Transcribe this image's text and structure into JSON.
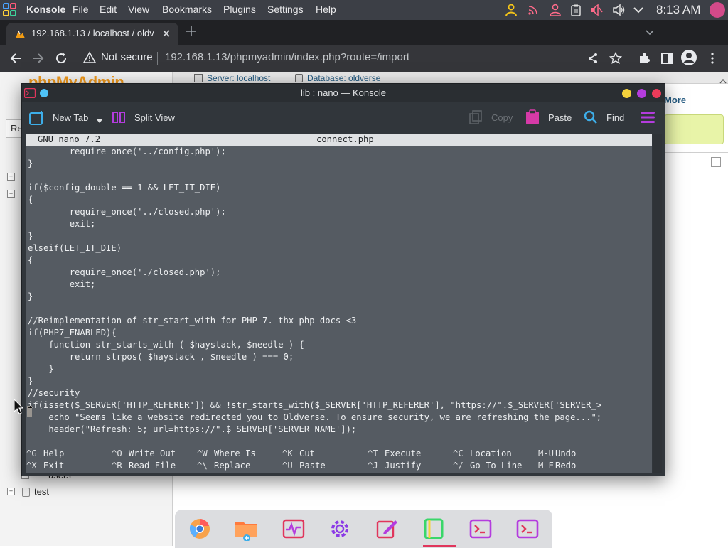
{
  "topbar": {
    "app_name": "Konsole",
    "menu": [
      "File",
      "Edit",
      "View",
      "Bookmarks",
      "Plugins",
      "Settings",
      "Help"
    ],
    "clock": "8:13 AM",
    "bg_color": "#3c3f46"
  },
  "browser": {
    "tab_title": "192.168.1.13 / localhost / oldv",
    "security_label": "Not secure",
    "url": "192.168.1.13/phpmyadmin/index.php?route=/import"
  },
  "pma": {
    "logo_text": "phpMyAdmin",
    "breadcrumb_server": "Server: localhost",
    "breadcrumb_db": "Database: oldverse",
    "more_label": "More",
    "re_button": "Re",
    "tree_items": [
      "users",
      "test"
    ]
  },
  "konsole": {
    "title": "lib : nano — Konsole",
    "new_tab": "New Tab",
    "split_view": "Split View",
    "copy": "Copy",
    "paste": "Paste",
    "find": "Find"
  },
  "nano": {
    "version": "GNU nano 7.2",
    "filename": "connect.php",
    "lines": [
      "        require_once('../config.php');",
      "}",
      "",
      "if($config_double == 1 && LET_IT_DIE)",
      "{",
      "        require_once('../closed.php');",
      "        exit;",
      "}",
      "elseif(LET_IT_DIE)",
      "{",
      "        require_once('./closed.php');",
      "        exit;",
      "}",
      "",
      "//Reimplementation of str_start_with for PHP 7. thx php docs <3",
      "if(PHP7_ENABLED){",
      "    function str_starts_with ( $haystack, $needle ) {",
      "        return strpos( $haystack , $needle ) === 0;",
      "    }",
      "}",
      "//security",
      "if(isset($_SERVER['HTTP_REFERER']) && !str_starts_with($_SERVER['HTTP_REFERER'], \"https://\".$_SERVER['SERVER_>",
      "    echo \"Seems like a website redirected you to Oldverse. To ensure security, we are refreshing the page...\";",
      "    header(\"Refresh: 5; url=https://\".$_SERVER['SERVER_NAME']);"
    ],
    "shortcuts_row1": [
      {
        "key": "^G",
        "label": "Help"
      },
      {
        "key": "^O",
        "label": "Write Out"
      },
      {
        "key": "^W",
        "label": "Where Is"
      },
      {
        "key": "^K",
        "label": "Cut"
      },
      {
        "key": "^T",
        "label": "Execute"
      },
      {
        "key": "^C",
        "label": "Location"
      },
      {
        "key": "M-U",
        "label": "Undo"
      }
    ],
    "shortcuts_row2": [
      {
        "key": "^X",
        "label": "Exit"
      },
      {
        "key": "^R",
        "label": "Read File"
      },
      {
        "key": "^\\",
        "label": "Replace"
      },
      {
        "key": "^U",
        "label": "Paste"
      },
      {
        "key": "^J",
        "label": "Justify"
      },
      {
        "key": "^/",
        "label": "Go To Line"
      },
      {
        "key": "M-E",
        "label": "Redo"
      }
    ]
  },
  "dock": {
    "items": [
      "chromium-icon",
      "files-icon",
      "system-monitor-icon",
      "settings-icon",
      "text-editor-icon",
      "kate-icon",
      "konsole-icon",
      "konsole-icon"
    ]
  }
}
